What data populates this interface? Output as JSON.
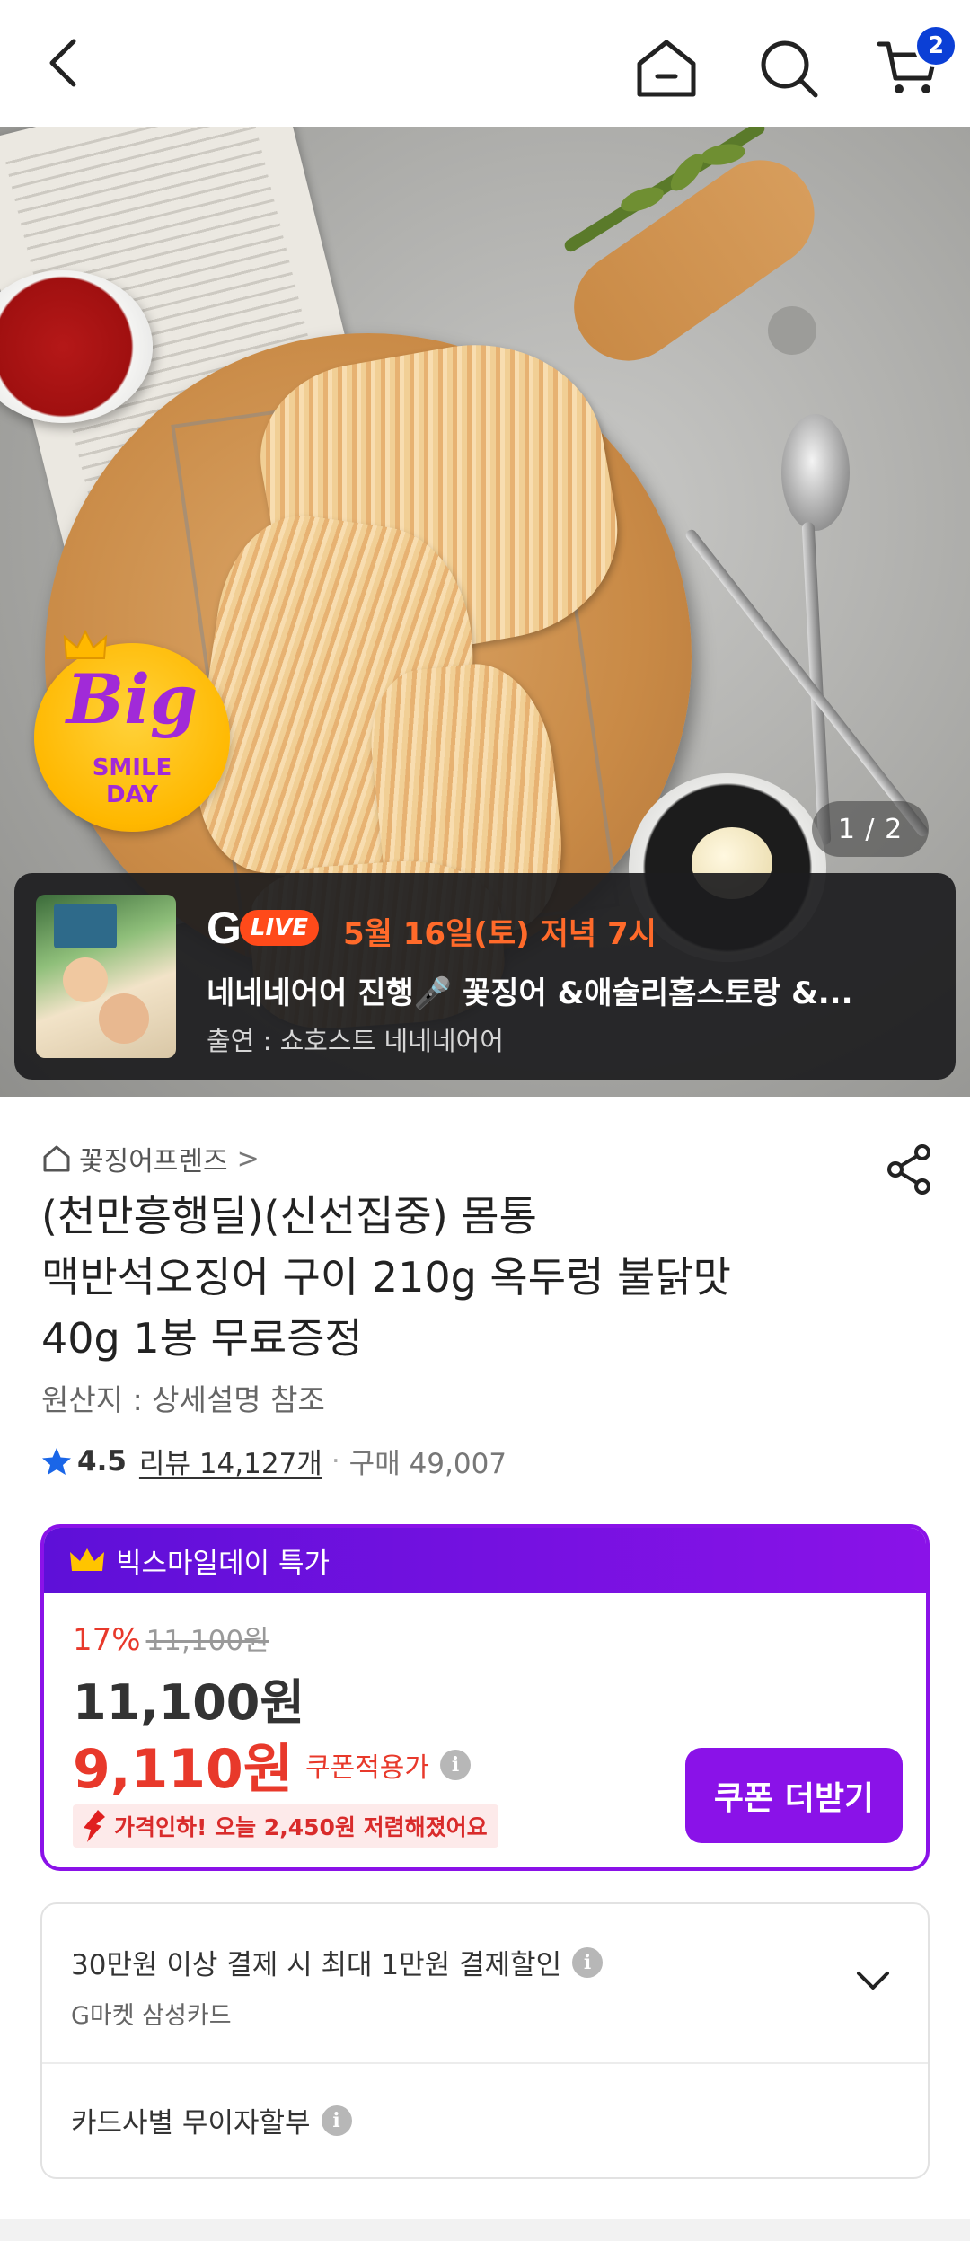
{
  "header": {
    "back_icon": "chevron-left-icon",
    "home_icon": "home-icon",
    "search_icon": "search-icon",
    "cart_icon": "cart-icon",
    "cart_count": "2",
    "badge_color": "#0b3fd6"
  },
  "hero": {
    "image_counter": "1 / 2",
    "badge": {
      "big": "Big",
      "line1": "SMILE",
      "line2": "DAY"
    },
    "live": {
      "logo_g": "G",
      "logo_live": "LIVE",
      "date": "5월 16일(토) 저녁 7시",
      "title": "네네네어어 진행🎤 꽃징어 &애슐리홈스토랑 &...",
      "cast": "출연 : 쇼호스트 네네네어어"
    }
  },
  "product": {
    "seller": "꽃징어프렌즈",
    "seller_chevron": ">",
    "title_lines": [
      "(천만흥행딜)(신선집중) 몸통",
      "맥반석오징어 구이 210g 옥두렁 불닭맛",
      "40g 1봉 무료증정"
    ],
    "origin": "원산지 : 상세설명 참조",
    "rating": "4.5",
    "review_label": "리뷰 14,127개",
    "dot": "·",
    "purchase_label": "구매 49,007"
  },
  "price": {
    "header": "빅스마일데이 특가",
    "discount_pct": "17%",
    "original_price": "11,100원",
    "sale_price": "11,100원",
    "coupon_price": "9,110원",
    "coupon_label": "쿠폰적용가",
    "info_icon": "i",
    "drop_note": "가격인하! 오늘 2,450원 저렴해졌어요",
    "coupon_button": "쿠폰 더받기",
    "accent_color": "#8a12e8",
    "sale_color": "#e8392b"
  },
  "payment": {
    "main": "30만원 이상 결제 시 최대 1만원 결제할인",
    "sub": "G마켓 삼성카드",
    "installment": "카드사별 무이자할부",
    "info_icon": "i"
  }
}
